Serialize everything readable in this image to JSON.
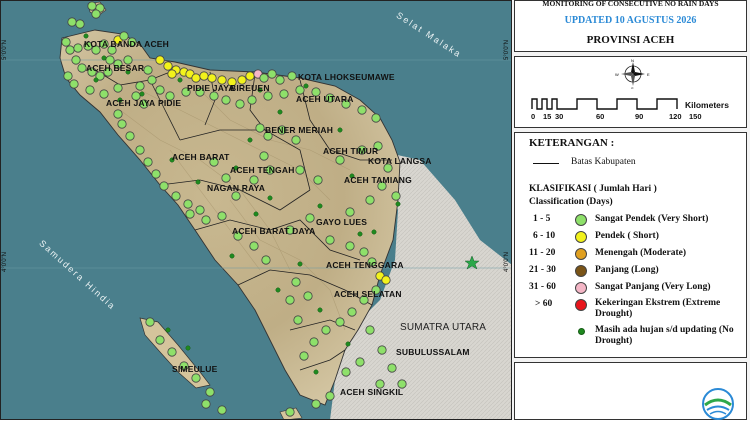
{
  "header": {
    "subtitle": "MONITORING OF CONSECUTIVE NO RAIN DAYS",
    "updated": "UPDATED 10 AGUSTUS 2026",
    "province": "PROVINSI ACEH"
  },
  "scale": {
    "unit": "Kilometers",
    "ticks": [
      "0",
      "15",
      "30",
      "60",
      "90",
      "120",
      "150"
    ]
  },
  "legend": {
    "title": "KETERANGAN :",
    "boundary_label": "Batas Kabupaten",
    "class_title": "KLASIFIKASI ( Jumlah Hari )",
    "class_subtitle": "Classification (Days)",
    "classes": [
      {
        "range": "1 - 5",
        "label": "Sangat Pendek (Very Short)",
        "color": "#8ee06a"
      },
      {
        "range": "6 - 10",
        "label": "Pendek ( Short)",
        "color": "#f2f21c"
      },
      {
        "range": "11 - 20",
        "label": "Menengah (Moderate)",
        "color": "#e0a020"
      },
      {
        "range": "21 - 30",
        "label": "Panjang (Long)",
        "color": "#7a5417"
      },
      {
        "range": "31 - 60",
        "label": "Sangat Panjang (Very Long)",
        "color": "#f4b6c6"
      },
      {
        "range": "> 60",
        "label": "Kekeringan Ekstrem (Extreme Drought)",
        "color": "#e8151c"
      }
    ],
    "no_drought": {
      "label": "Masih ada hujan s/d updating (No Drought)",
      "color": "#1f8a1f"
    }
  },
  "map": {
    "seas": {
      "malaka": "Selat Malaka",
      "hindia": "Samudera Hindia"
    },
    "coords": [
      "5°0'0\"N",
      "4°0'0\"N",
      "5°0'0\"N",
      "4°0'0\"N"
    ],
    "regions": [
      "KOTA BANDA ACEH",
      "ACEH BESAR",
      "PIDIE",
      "PIDIE JAYA",
      "BIREUEN",
      "KOTA LHOKSEUMAWE",
      "ACEH UTARA",
      "ACEH JAYA",
      "BENER MERIAH",
      "ACEH TIMUR",
      "KOTA LANGSA",
      "ACEH TAMIANG",
      "ACEH BARAT",
      "ACEH TENGAH",
      "NAGAN RAYA",
      "GAYO LUES",
      "ACEH BARAT DAYA",
      "ACEH TENGGARA",
      "ACEH SELATAN",
      "SUMATRA UTARA",
      "SUBULUSSALAM",
      "SIMEULUE",
      "ACEH SINGKIL"
    ]
  }
}
